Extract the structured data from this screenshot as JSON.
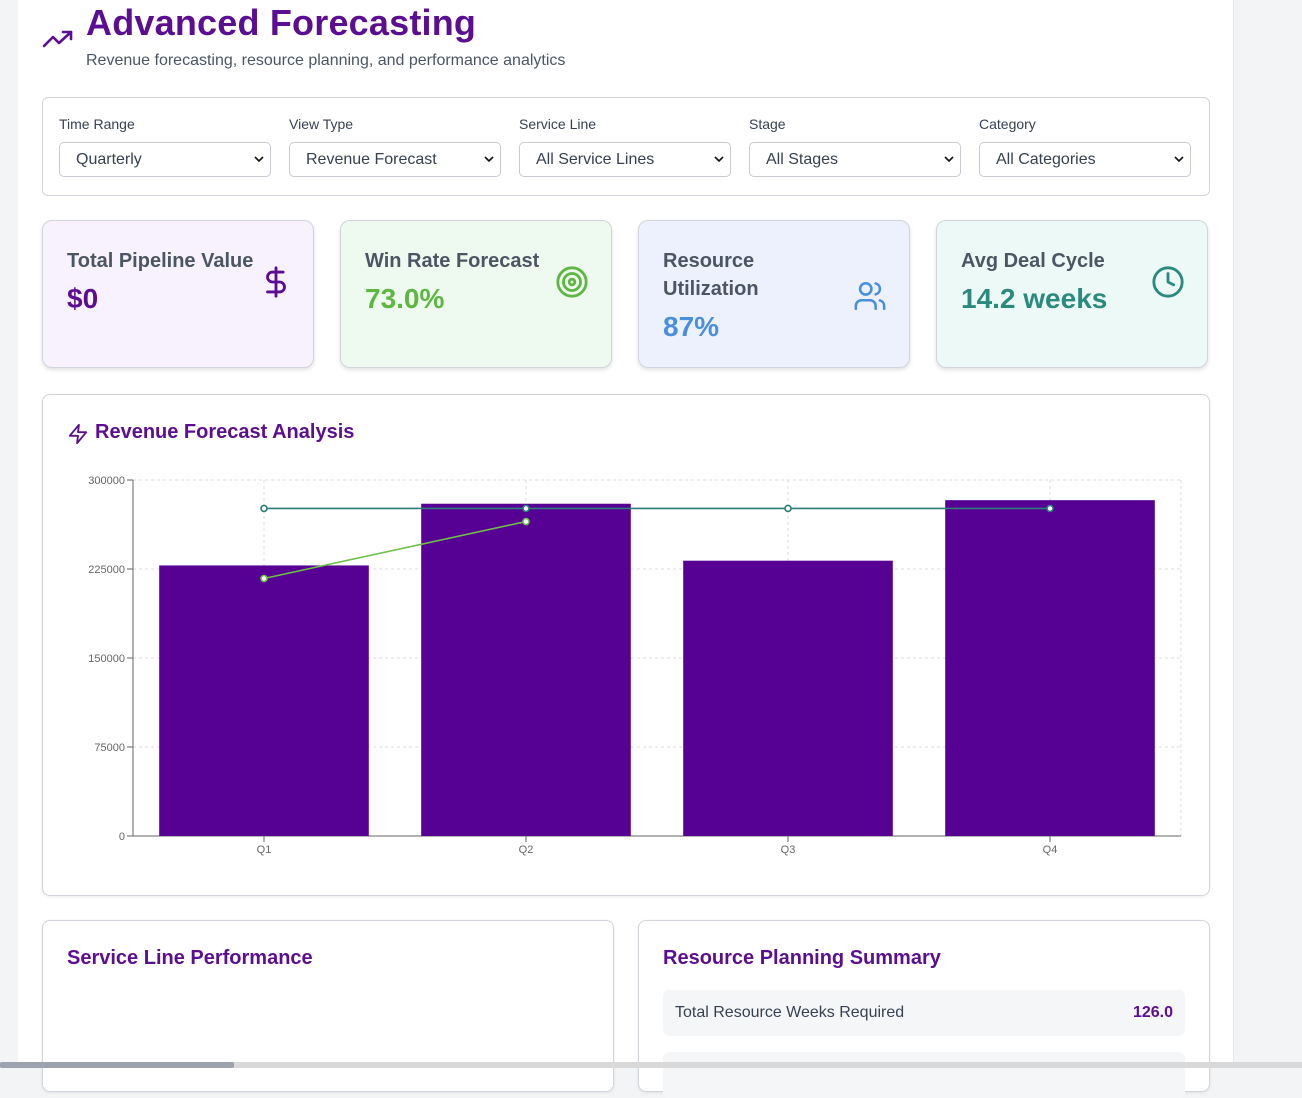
{
  "header": {
    "icon": "trending-up-icon",
    "title": "Advanced Forecasting",
    "subtitle": "Revenue forecasting, resource planning, and performance analytics"
  },
  "filters": [
    {
      "label": "Time Range",
      "value": "Quarterly"
    },
    {
      "label": "View Type",
      "value": "Revenue Forecast"
    },
    {
      "label": "Service Line",
      "value": "All Service Lines"
    },
    {
      "label": "Stage",
      "value": "All Stages"
    },
    {
      "label": "Category",
      "value": "All Categories"
    }
  ],
  "metrics": [
    {
      "label": "Total Pipeline Value",
      "value": "$0",
      "icon": "dollar-icon",
      "color": "#5b0e91",
      "bg": "#f7f2fd"
    },
    {
      "label": "Win Rate Forecast",
      "value": "73.0%",
      "icon": "target-icon",
      "color": "#5fb743",
      "bg": "#eefaef"
    },
    {
      "label": "Resource Utilization",
      "value": "87%",
      "icon": "users-icon",
      "color": "#4a8fde",
      "bg": "#ecf1fd"
    },
    {
      "label": "Avg Deal Cycle",
      "value": "14.2 weeks",
      "icon": "clock-icon",
      "color": "#2a8a7e",
      "bg": "#edf9f6"
    }
  ],
  "forecast_panel": {
    "title": "Revenue Forecast Analysis",
    "icon": "zap-icon"
  },
  "chart_data": {
    "type": "bar",
    "categories": [
      "Q1",
      "Q2",
      "Q3",
      "Q4"
    ],
    "ylim": [
      0,
      300000
    ],
    "yticks": [
      "0",
      "75000",
      "150000",
      "225000",
      "300000"
    ],
    "grid": true,
    "series": [
      {
        "type": "bar",
        "values": [
          228000,
          280000,
          232000,
          283000
        ],
        "color": "#560094"
      },
      {
        "type": "line",
        "values": [
          276000,
          276000,
          276000,
          276000
        ],
        "color": "#2e7d7a"
      },
      {
        "type": "line",
        "values": [
          217000,
          265000,
          null,
          null
        ],
        "color": "#6fbf4a"
      }
    ]
  },
  "service_panel": {
    "title": "Service Line Performance"
  },
  "resource_panel": {
    "title": "Resource Planning Summary",
    "rows": [
      {
        "label": "Total Resource Weeks Required",
        "value": "126.0"
      }
    ]
  }
}
